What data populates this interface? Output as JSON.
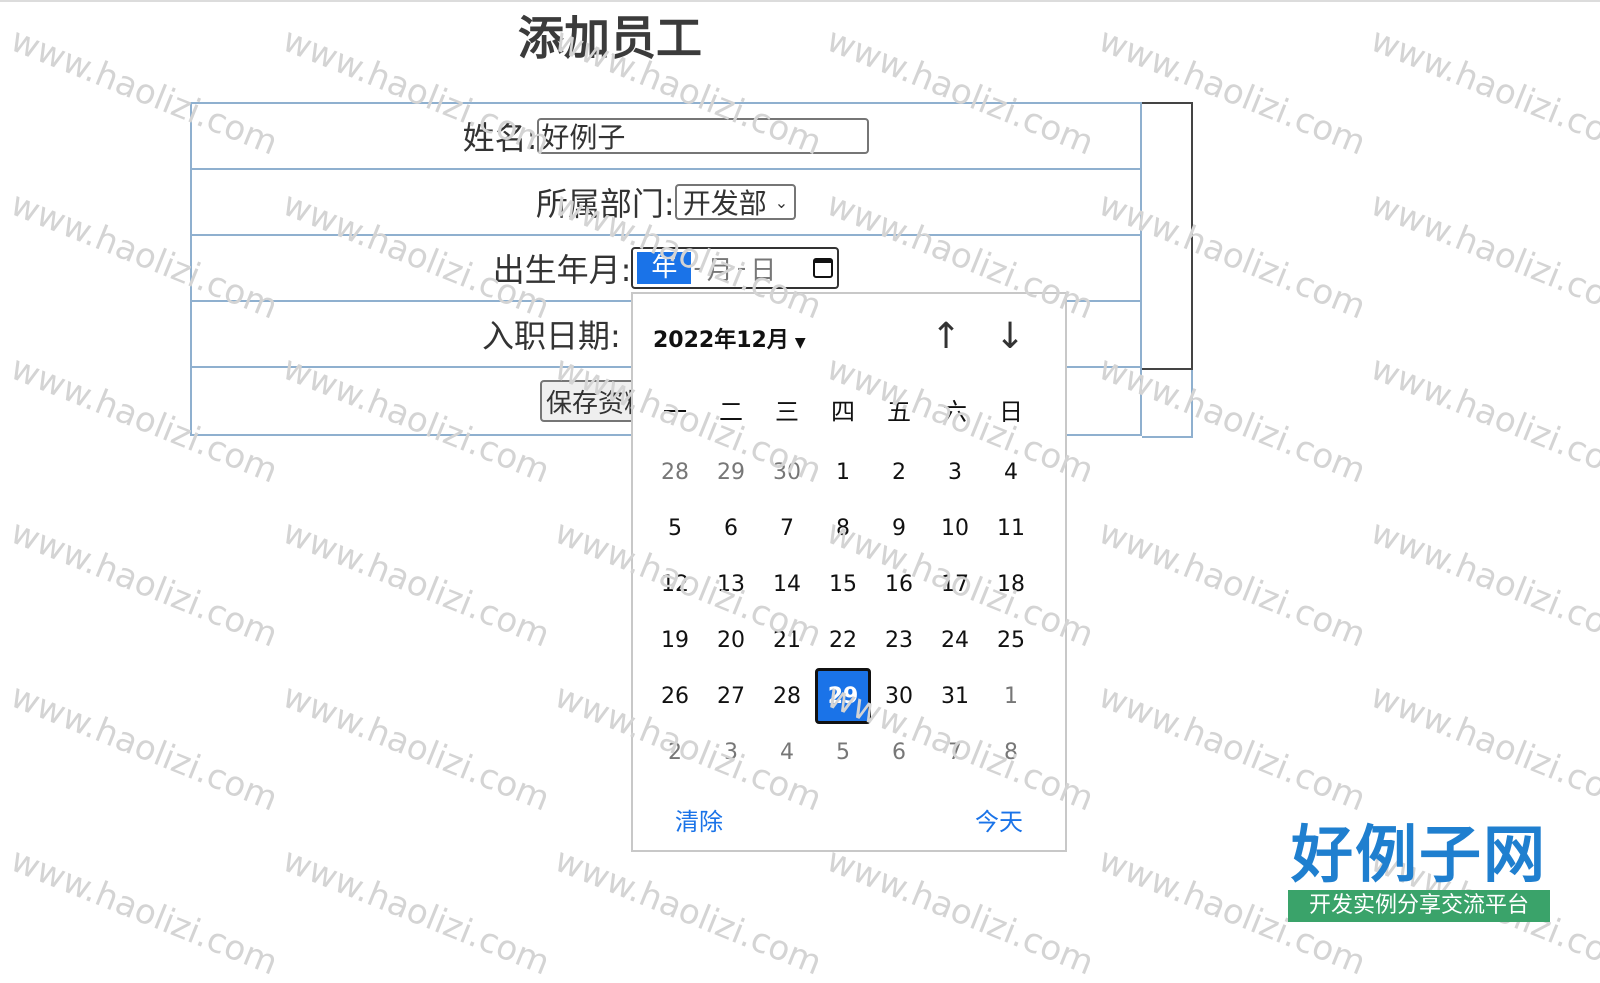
{
  "page": {
    "title": "添加员工"
  },
  "form": {
    "name_label": "姓名:",
    "name_value": "好例子",
    "dept_label": "所属部门:",
    "dept_selected": "开发部",
    "birth_label": "出生年月:",
    "birth_year_seg": "年",
    "birth_month_seg": "月",
    "birth_day_seg": "日",
    "hire_label": "入职日期:",
    "save_label": "保存资料"
  },
  "calendar": {
    "month_label": "2022年12月",
    "weekdays": [
      "一",
      "二",
      "三",
      "四",
      "五",
      "六",
      "日"
    ],
    "days": [
      {
        "d": "28",
        "m": true
      },
      {
        "d": "29",
        "m": true
      },
      {
        "d": "30",
        "m": true
      },
      {
        "d": "1"
      },
      {
        "d": "2"
      },
      {
        "d": "3"
      },
      {
        "d": "4"
      },
      {
        "d": "5"
      },
      {
        "d": "6"
      },
      {
        "d": "7"
      },
      {
        "d": "8"
      },
      {
        "d": "9"
      },
      {
        "d": "10"
      },
      {
        "d": "11"
      },
      {
        "d": "12"
      },
      {
        "d": "13"
      },
      {
        "d": "14"
      },
      {
        "d": "15"
      },
      {
        "d": "16"
      },
      {
        "d": "17"
      },
      {
        "d": "18"
      },
      {
        "d": "19"
      },
      {
        "d": "20"
      },
      {
        "d": "21"
      },
      {
        "d": "22"
      },
      {
        "d": "23"
      },
      {
        "d": "24"
      },
      {
        "d": "25"
      },
      {
        "d": "26"
      },
      {
        "d": "27"
      },
      {
        "d": "28"
      },
      {
        "d": "29",
        "sel": true
      },
      {
        "d": "30"
      },
      {
        "d": "31"
      },
      {
        "d": "1",
        "m": true
      },
      {
        "d": "2",
        "m": true
      },
      {
        "d": "3",
        "m": true
      },
      {
        "d": "4",
        "m": true
      },
      {
        "d": "5",
        "m": true
      },
      {
        "d": "6",
        "m": true
      },
      {
        "d": "7",
        "m": true
      },
      {
        "d": "8",
        "m": true
      }
    ],
    "clear_label": "清除",
    "today_label": "今天"
  },
  "watermark": "www.haolizi.com",
  "logo": {
    "main": "好例子网",
    "sub": "开发实例分享交流平台"
  },
  "colors": {
    "accent": "#1a73e8",
    "table_border": "#8fb0cf",
    "logo_blue": "#1f7fcf",
    "logo_green": "#3aa36a"
  }
}
